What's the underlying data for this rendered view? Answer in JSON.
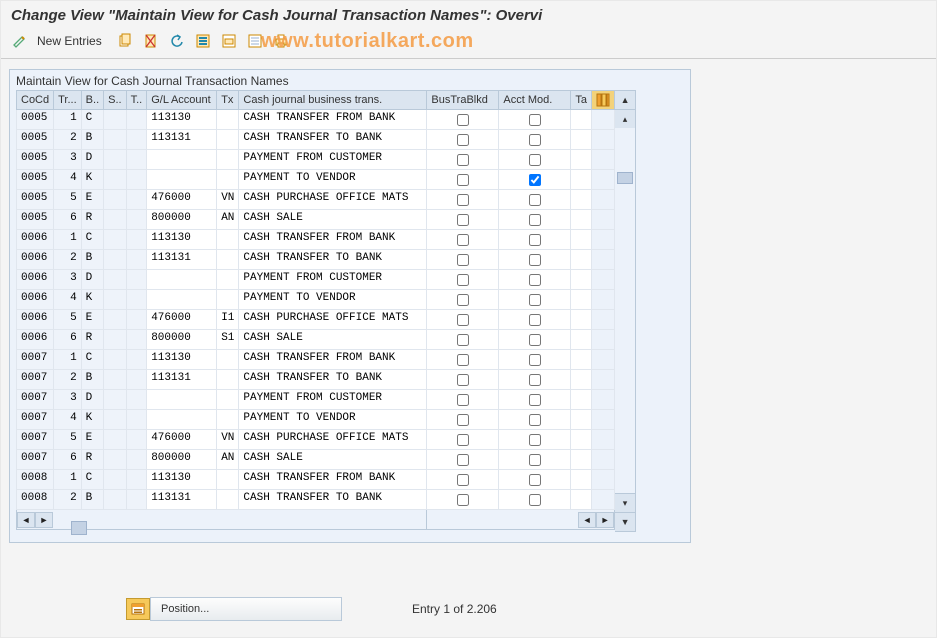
{
  "title": "Change View \"Maintain View for Cash Journal Transaction Names\": Overvi",
  "watermark": "www.tutorialkart.com",
  "toolbar": {
    "new_entries": "New Entries"
  },
  "panel": {
    "title": "Maintain View for Cash Journal Transaction Names"
  },
  "columns": {
    "cocd": "CoCd",
    "tr": "Tr...",
    "b": "B..",
    "s": "S..",
    "t": "T..",
    "gl": "G/L Account",
    "tx": "Tx",
    "bt": "Cash journal business trans.",
    "blkd": "BusTraBlkd",
    "acct": "Acct Mod.",
    "ta": "Ta"
  },
  "rows": [
    {
      "cocd": "0005",
      "tr": "1",
      "b": "C",
      "s": "",
      "t": "",
      "gl": "113130",
      "tx": "",
      "bt": "CASH TRANSFER FROM BANK",
      "blkd": false,
      "acct": false
    },
    {
      "cocd": "0005",
      "tr": "2",
      "b": "B",
      "s": "",
      "t": "",
      "gl": "113131",
      "tx": "",
      "bt": "CASH TRANSFER TO BANK",
      "blkd": false,
      "acct": false
    },
    {
      "cocd": "0005",
      "tr": "3",
      "b": "D",
      "s": "",
      "t": "",
      "gl": "",
      "tx": "",
      "bt": "PAYMENT FROM CUSTOMER",
      "blkd": false,
      "acct": false
    },
    {
      "cocd": "0005",
      "tr": "4",
      "b": "K",
      "s": "",
      "t": "",
      "gl": "",
      "tx": "",
      "bt": "PAYMENT TO VENDOR",
      "blkd": false,
      "acct": true
    },
    {
      "cocd": "0005",
      "tr": "5",
      "b": "E",
      "s": "",
      "t": "",
      "gl": "476000",
      "tx": "VN",
      "bt": "CASH PURCHASE OFFICE MATS",
      "blkd": false,
      "acct": false
    },
    {
      "cocd": "0005",
      "tr": "6",
      "b": "R",
      "s": "",
      "t": "",
      "gl": "800000",
      "tx": "AN",
      "bt": "CASH SALE",
      "blkd": false,
      "acct": false
    },
    {
      "cocd": "0006",
      "tr": "1",
      "b": "C",
      "s": "",
      "t": "",
      "gl": "113130",
      "tx": "",
      "bt": "CASH TRANSFER FROM BANK",
      "blkd": false,
      "acct": false
    },
    {
      "cocd": "0006",
      "tr": "2",
      "b": "B",
      "s": "",
      "t": "",
      "gl": "113131",
      "tx": "",
      "bt": "CASH TRANSFER TO BANK",
      "blkd": false,
      "acct": false
    },
    {
      "cocd": "0006",
      "tr": "3",
      "b": "D",
      "s": "",
      "t": "",
      "gl": "",
      "tx": "",
      "bt": "PAYMENT FROM CUSTOMER",
      "blkd": false,
      "acct": false
    },
    {
      "cocd": "0006",
      "tr": "4",
      "b": "K",
      "s": "",
      "t": "",
      "gl": "",
      "tx": "",
      "bt": "PAYMENT TO VENDOR",
      "blkd": false,
      "acct": false
    },
    {
      "cocd": "0006",
      "tr": "5",
      "b": "E",
      "s": "",
      "t": "",
      "gl": "476000",
      "tx": "I1",
      "bt": "CASH PURCHASE OFFICE MATS",
      "blkd": false,
      "acct": false
    },
    {
      "cocd": "0006",
      "tr": "6",
      "b": "R",
      "s": "",
      "t": "",
      "gl": "800000",
      "tx": "S1",
      "bt": "CASH SALE",
      "blkd": false,
      "acct": false
    },
    {
      "cocd": "0007",
      "tr": "1",
      "b": "C",
      "s": "",
      "t": "",
      "gl": "113130",
      "tx": "",
      "bt": "CASH TRANSFER FROM BANK",
      "blkd": false,
      "acct": false
    },
    {
      "cocd": "0007",
      "tr": "2",
      "b": "B",
      "s": "",
      "t": "",
      "gl": "113131",
      "tx": "",
      "bt": "CASH TRANSFER TO BANK",
      "blkd": false,
      "acct": false
    },
    {
      "cocd": "0007",
      "tr": "3",
      "b": "D",
      "s": "",
      "t": "",
      "gl": "",
      "tx": "",
      "bt": "PAYMENT FROM CUSTOMER",
      "blkd": false,
      "acct": false
    },
    {
      "cocd": "0007",
      "tr": "4",
      "b": "K",
      "s": "",
      "t": "",
      "gl": "",
      "tx": "",
      "bt": "PAYMENT TO VENDOR",
      "blkd": false,
      "acct": false
    },
    {
      "cocd": "0007",
      "tr": "5",
      "b": "E",
      "s": "",
      "t": "",
      "gl": "476000",
      "tx": "VN",
      "bt": "CASH PURCHASE OFFICE MATS",
      "blkd": false,
      "acct": false
    },
    {
      "cocd": "0007",
      "tr": "6",
      "b": "R",
      "s": "",
      "t": "",
      "gl": "800000",
      "tx": "AN",
      "bt": "CASH SALE",
      "blkd": false,
      "acct": false
    },
    {
      "cocd": "0008",
      "tr": "1",
      "b": "C",
      "s": "",
      "t": "",
      "gl": "113130",
      "tx": "",
      "bt": "CASH TRANSFER FROM BANK",
      "blkd": false,
      "acct": false
    },
    {
      "cocd": "0008",
      "tr": "2",
      "b": "B",
      "s": "",
      "t": "",
      "gl": "113131",
      "tx": "",
      "bt": "CASH TRANSFER TO BANK",
      "blkd": false,
      "acct": false
    }
  ],
  "footer": {
    "position": "Position...",
    "entry": "Entry 1 of 2.206"
  }
}
